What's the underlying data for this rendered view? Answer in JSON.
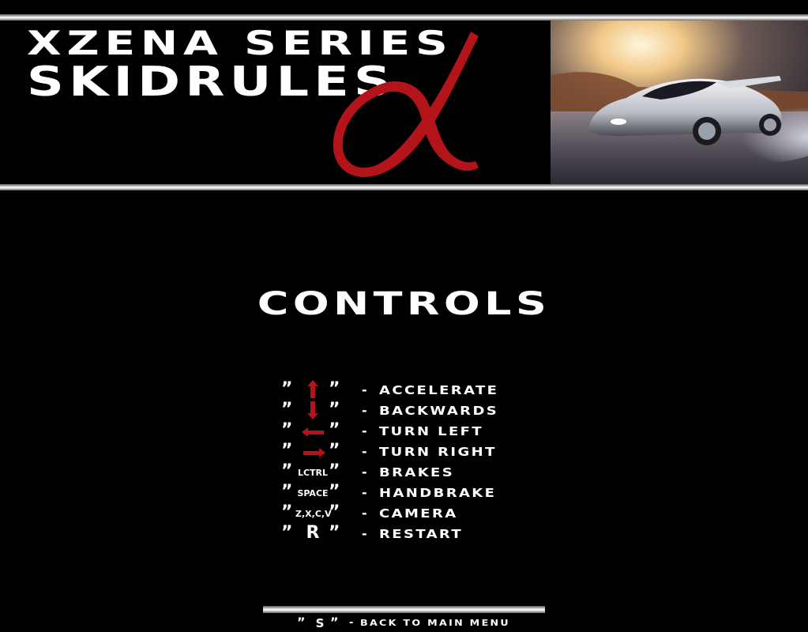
{
  "banner": {
    "title_line1": "XZENA SERIES",
    "title_line2": "SKIDRULES",
    "logo_glyph": "α",
    "logo_color": "#b3141a"
  },
  "heading": "CONTROLS",
  "quote_mark": "”",
  "controls": [
    {
      "key": "",
      "icon": "arrow-up-icon",
      "action": "ACCELERATE"
    },
    {
      "key": "",
      "icon": "arrow-down-icon",
      "action": "BACKWARDS"
    },
    {
      "key": "",
      "icon": "arrow-left-icon",
      "action": "TURN LEFT"
    },
    {
      "key": "",
      "icon": "arrow-right-icon",
      "action": "TURN RIGHT"
    },
    {
      "key": "LCTRL",
      "icon": "",
      "action": "BRAKES"
    },
    {
      "key": "SPACE",
      "icon": "",
      "action": "HANDBRAKE"
    },
    {
      "key": "Z,X,C,V",
      "icon": "",
      "action": "CAMERA"
    },
    {
      "key": "R",
      "icon": "",
      "action": "RESTART"
    }
  ],
  "dash": "-",
  "footer": {
    "key": "S",
    "action": "BACK TO MAIN MENU"
  },
  "colors": {
    "arrow": "#b3141a",
    "background": "#000000",
    "text": "#ffffff"
  }
}
